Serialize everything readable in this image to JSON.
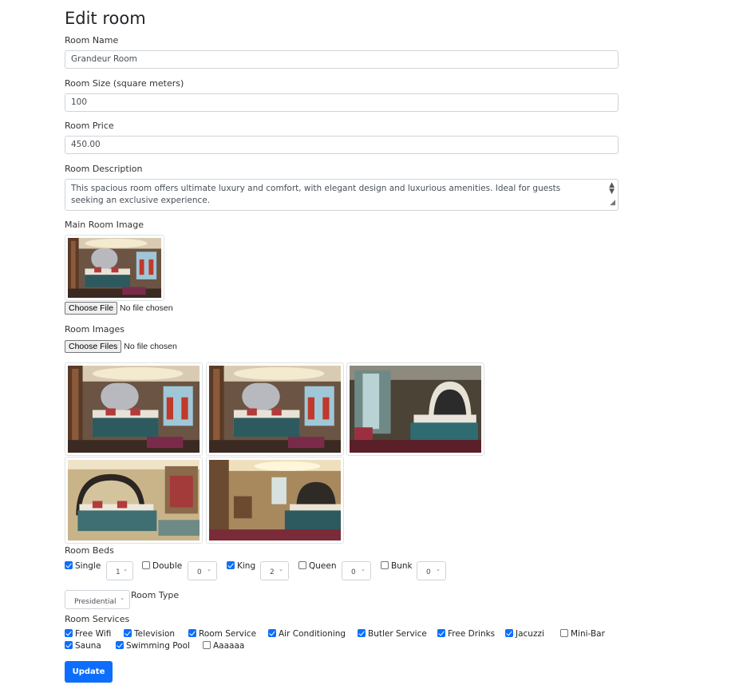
{
  "page_title": "Edit room",
  "room_name": {
    "label": "Room Name",
    "value": "Grandeur Room"
  },
  "room_size": {
    "label": "Room Size (square meters)",
    "value": "100"
  },
  "room_price": {
    "label": "Room Price",
    "value": "450.00"
  },
  "room_description": {
    "label": "Room Description",
    "value": "This spacious room offers ultimate luxury and comfort, with elegant design and luxurious amenities. Ideal for guests seeking an exclusive experience."
  },
  "main_image": {
    "label": "Main Room Image",
    "button": "Choose File",
    "status": "No file chosen"
  },
  "room_images": {
    "label": "Room Images",
    "button": "Choose Files",
    "status": "No file chosen"
  },
  "beds": {
    "label": "Room Beds",
    "items": [
      {
        "name": "Single",
        "checked": true,
        "count": "1"
      },
      {
        "name": "Double",
        "checked": false,
        "count": "0"
      },
      {
        "name": "King",
        "checked": true,
        "count": "2"
      },
      {
        "name": "Queen",
        "checked": false,
        "count": "0"
      },
      {
        "name": "Bunk",
        "checked": false,
        "count": "0"
      }
    ]
  },
  "room_type": {
    "label": "Room Type",
    "value": "Presidential"
  },
  "services": {
    "label": "Room Services",
    "items": [
      {
        "name": "Free Wifi",
        "checked": true
      },
      {
        "name": "Television",
        "checked": true
      },
      {
        "name": "Room Service",
        "checked": true
      },
      {
        "name": "Air Conditioning",
        "checked": true
      },
      {
        "name": "Butler Service",
        "checked": true
      },
      {
        "name": "Free Drinks",
        "checked": true
      },
      {
        "name": "Jacuzzi",
        "checked": true
      },
      {
        "name": "Mini-Bar",
        "checked": false
      },
      {
        "name": "Sauna",
        "checked": true
      },
      {
        "name": "Swimming Pool",
        "checked": true
      },
      {
        "name": "Aaaaaa",
        "checked": false
      }
    ]
  },
  "update_button": "Update",
  "colors": {
    "primary": "#0d6efd",
    "border": "#ced4da"
  }
}
